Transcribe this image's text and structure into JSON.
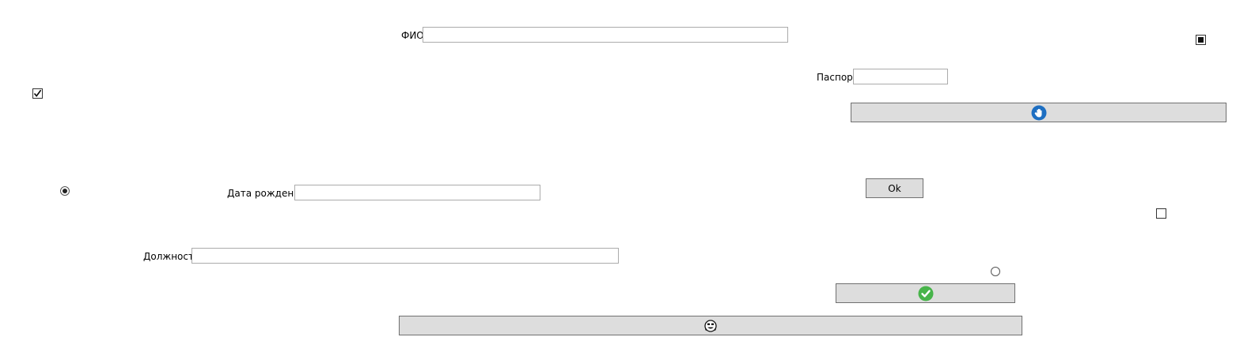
{
  "form": {
    "fio": {
      "label": "ФИО",
      "value": "",
      "placeholder": ""
    },
    "passport": {
      "label": "Паспорт",
      "value": "",
      "placeholder": ""
    },
    "birth_date": {
      "label": "Дата рождения",
      "value": "",
      "placeholder": ""
    },
    "position": {
      "label": "Должность",
      "value": "",
      "placeholder": ""
    }
  },
  "buttons": {
    "ok_label": "Ok",
    "hand_icon": "hand-stop-icon",
    "check_icon": "green-check-icon",
    "face_icon": "face-icon"
  },
  "controls": {
    "checkbox_left_checked": true,
    "checkbox_top_right_state": "indeterminate",
    "checkbox_right_checked": false,
    "radio_left_selected": true,
    "radio_right_selected": false
  },
  "colors": {
    "button_bg": "#dddddd",
    "hand_icon_blue": "#1e6fc2",
    "check_icon_green": "#47b44a"
  }
}
